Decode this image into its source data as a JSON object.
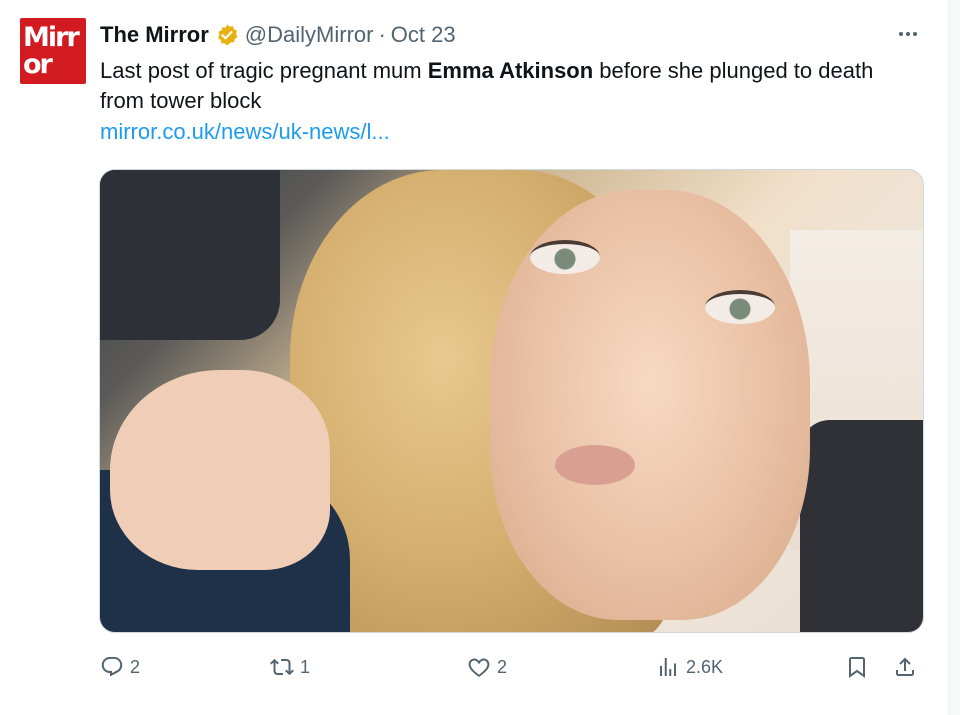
{
  "account": {
    "name": "The Mirror",
    "handle": "@DailyMirror",
    "separator": "·",
    "date": "Oct 23",
    "avatar_text_line1": "Mirr",
    "avatar_text_line2": "or"
  },
  "tweet": {
    "text_before": "Last post of tragic pregnant mum ",
    "text_bold": "Emma Atkinson",
    "text_after": " before she plunged to death from tower block",
    "link": "mirror.co.uk/news/uk-news/l..."
  },
  "actions": {
    "replies": "2",
    "retweets": "1",
    "likes": "2",
    "views": "2.6K"
  },
  "colors": {
    "brand_red": "#d21b21",
    "link_blue": "#1d9bf0",
    "muted": "#536471",
    "verified_gold": "#e8b10f"
  },
  "icons": [
    "verified-badge-icon",
    "more-icon",
    "reply-icon",
    "retweet-icon",
    "like-icon",
    "views-icon",
    "bookmark-icon",
    "share-icon"
  ]
}
